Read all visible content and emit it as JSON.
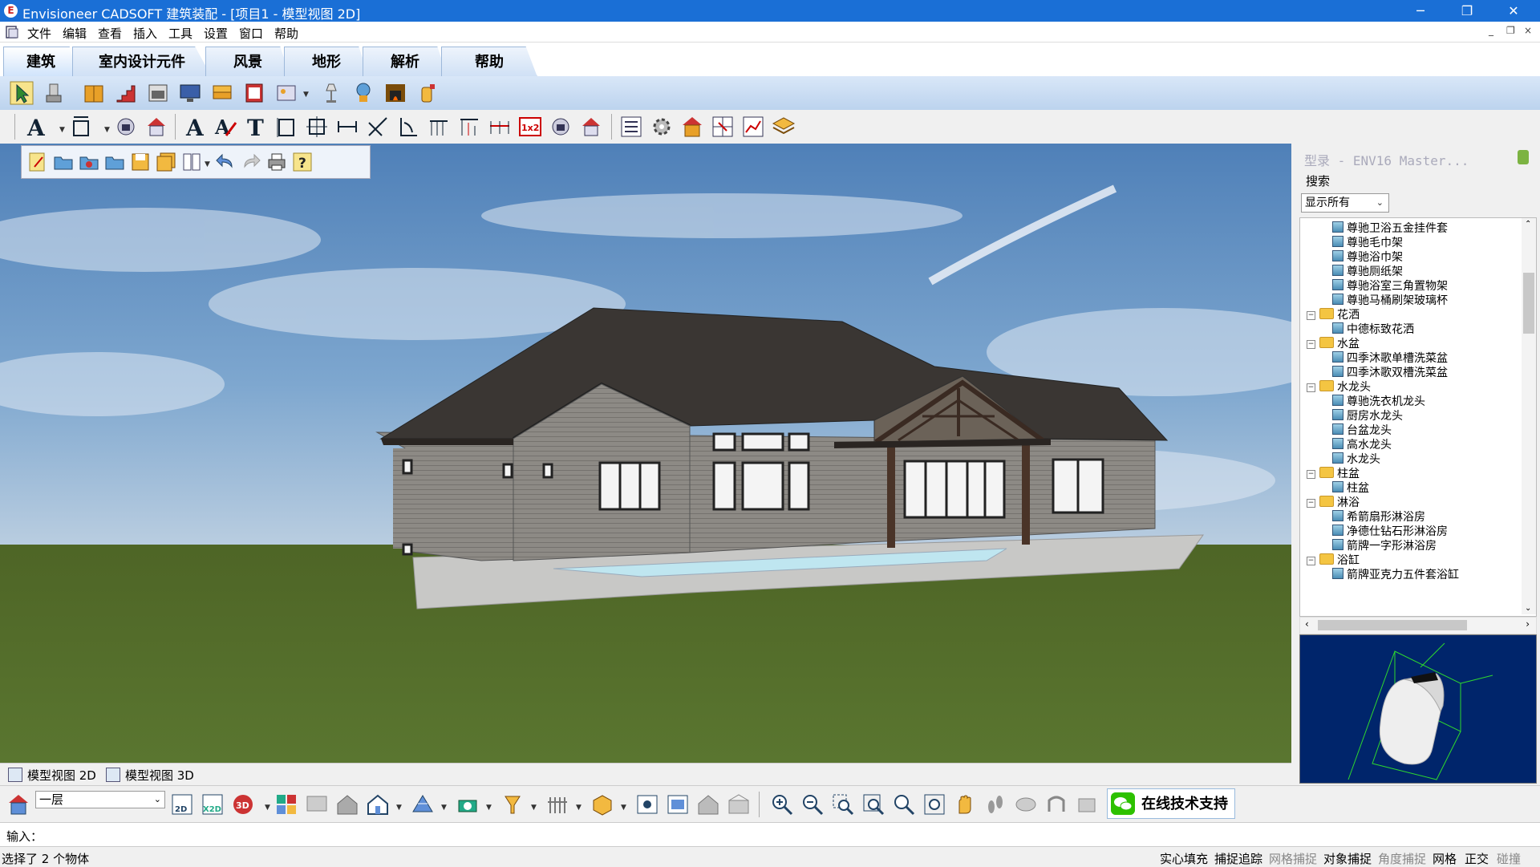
{
  "window": {
    "title": "Envisioneer CADSOFT 建筑装配 - [项目1 - 模型视图 2D]",
    "minimize": "─",
    "restore": "❐",
    "close": "✕"
  },
  "menu": {
    "items": [
      "文件",
      "编辑",
      "查看",
      "插入",
      "工具",
      "设置",
      "窗口",
      "帮助"
    ],
    "mdi_controls": [
      "_",
      "❐",
      "×"
    ]
  },
  "ribbon": {
    "tabs": [
      "建筑",
      "室内设计元件",
      "风景",
      "地形",
      "解析",
      "帮助"
    ],
    "active_tab": "建筑"
  },
  "catalog": {
    "title": "型录 - ENV16 Master...",
    "search_label": "搜索",
    "filter_value": "显示所有",
    "tree": [
      {
        "type": "item",
        "label": "尊驰卫浴五金挂件套"
      },
      {
        "type": "item",
        "label": "尊驰毛巾架"
      },
      {
        "type": "item",
        "label": "尊驰浴巾架"
      },
      {
        "type": "item",
        "label": "尊驰厕纸架"
      },
      {
        "type": "item",
        "label": "尊驰浴室三角置物架"
      },
      {
        "type": "item",
        "label": "尊驰马桶刷架玻璃杯"
      },
      {
        "type": "folder",
        "label": "花洒"
      },
      {
        "type": "item",
        "label": "中德标致花洒"
      },
      {
        "type": "folder",
        "label": "水盆"
      },
      {
        "type": "item",
        "label": "四季沐歌单槽洗菜盆"
      },
      {
        "type": "item",
        "label": "四季沐歌双槽洗菜盆"
      },
      {
        "type": "folder",
        "label": "水龙头"
      },
      {
        "type": "item",
        "label": "尊驰洗衣机龙头"
      },
      {
        "type": "item",
        "label": "厨房水龙头"
      },
      {
        "type": "item",
        "label": "台盆龙头"
      },
      {
        "type": "item",
        "label": "高水龙头"
      },
      {
        "type": "item",
        "label": "水龙头"
      },
      {
        "type": "folder",
        "label": "柱盆"
      },
      {
        "type": "item",
        "label": "柱盆"
      },
      {
        "type": "folder",
        "label": "淋浴"
      },
      {
        "type": "item",
        "label": "希箭扇形淋浴房"
      },
      {
        "type": "item",
        "label": "净德仕钻石形淋浴房"
      },
      {
        "type": "item",
        "label": "箭牌一字形淋浴房"
      },
      {
        "type": "folder",
        "label": "浴缸"
      },
      {
        "type": "item",
        "label": "箭牌亚克力五件套浴缸"
      }
    ]
  },
  "view_tabs": [
    {
      "label": "模型视图 2D"
    },
    {
      "label": "模型视图 3D"
    }
  ],
  "bottom": {
    "floor_value": "一层",
    "support_label": "在线技术支持"
  },
  "input": {
    "label": "输入："
  },
  "status": {
    "message": "选择了 2 个物体",
    "toggles": [
      {
        "label": "实心填充",
        "on": true
      },
      {
        "label": "捕捉追踪",
        "on": true
      },
      {
        "label": "网格捕捉",
        "on": false
      },
      {
        "label": "对象捕捉",
        "on": true
      },
      {
        "label": "角度捕捉",
        "on": false
      },
      {
        "label": "网格",
        "on": true
      },
      {
        "label": "正交",
        "on": true
      },
      {
        "label": "碰撞",
        "on": false
      }
    ]
  },
  "colors": {
    "titlebar": "#1a6fd6",
    "sky": "#5f8fbf",
    "grass": "#556b2a",
    "roof": "#3a3633",
    "siding": "#8c8984",
    "preview_bg": "#00256b"
  }
}
